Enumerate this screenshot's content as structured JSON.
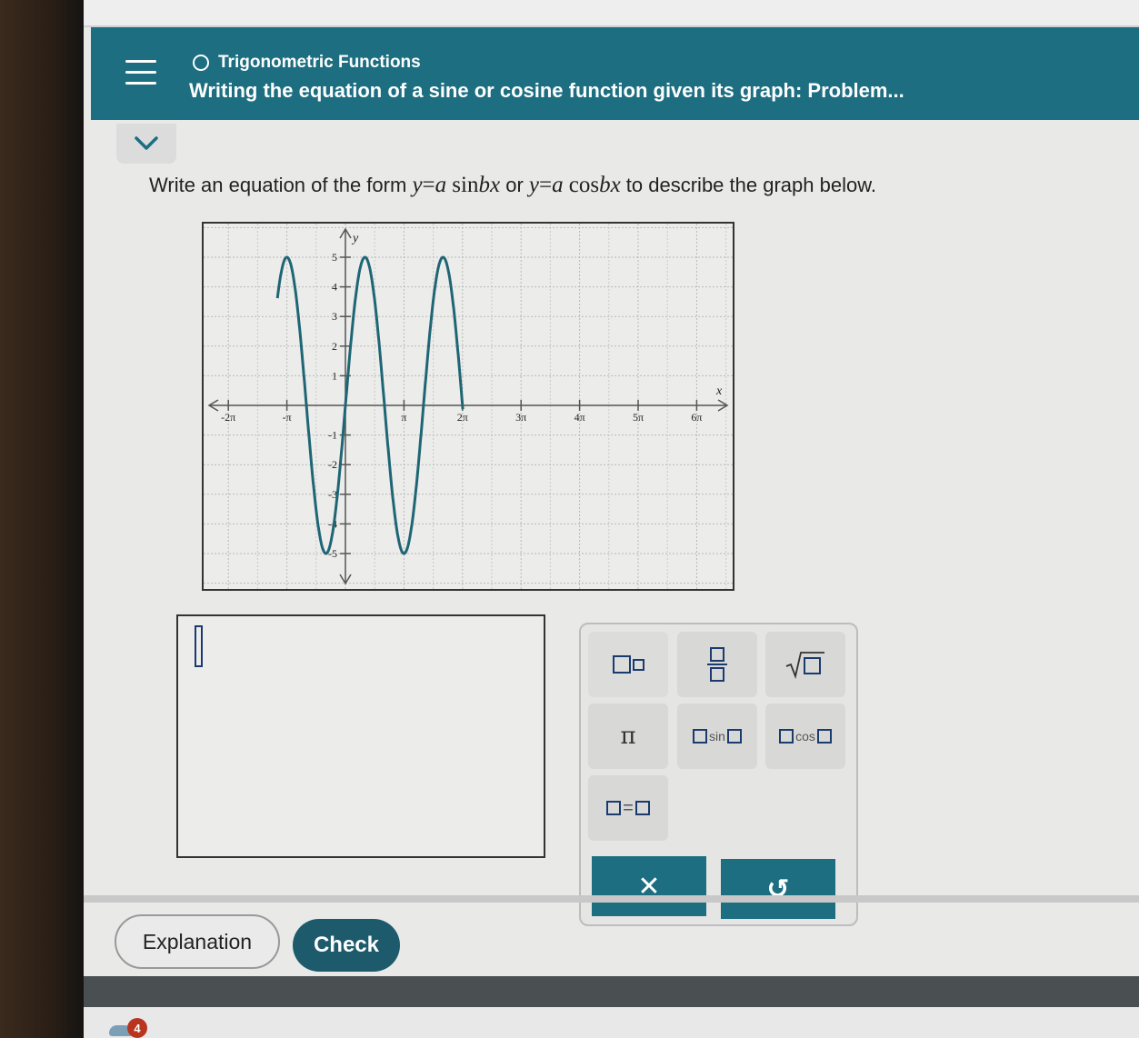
{
  "header": {
    "topic": "Trigonometric Functions",
    "title": "Writing the equation of a sine or cosine function given its graph: Problem..."
  },
  "instructions": {
    "before": "Write an equation of the form",
    "y1": "y",
    "eq1": "=",
    "a1": "a",
    "sin": "sin",
    "bx1": "bx",
    "or": "or",
    "y2": "y",
    "eq2": "=",
    "a2": "a",
    "cos": "cos",
    "bx2": "bx",
    "after": "to describe the graph below."
  },
  "chart_data": {
    "type": "line",
    "xlabel": "x",
    "ylabel": "y",
    "xlim": [
      -3.65,
      6.3
    ],
    "ylim": [
      -6,
      6
    ],
    "x_ticks": [
      "-2π",
      "-π",
      "π",
      "2π",
      "3π",
      "4π",
      "5π",
      "6π"
    ],
    "y_ticks": [
      "5",
      "4",
      "3",
      "2",
      "1",
      "-1",
      "-2",
      "-3",
      "-4",
      "-5"
    ],
    "series": [
      {
        "function": "y = 5 sin(3x/2)",
        "amplitude": 5,
        "period": "4π/3",
        "x": [
          -3.4,
          -3.14,
          -2.6,
          -2.09,
          -1.6,
          -1.05,
          -0.5,
          0,
          0.5,
          1.05,
          1.6,
          2.09,
          2.6,
          3.14,
          3.7,
          4.19,
          4.7,
          5.24,
          5.76,
          6.28
        ],
        "y": [
          4.6,
          0,
          -3.5,
          0,
          3.4,
          0,
          -3.5,
          0,
          3.4,
          5,
          3.4,
          0,
          -3.5,
          -5,
          -3.5,
          0,
          3.4,
          5,
          3.4,
          0
        ]
      }
    ],
    "grid": true,
    "color": "#1f6675"
  },
  "answer": {
    "value": ""
  },
  "keypad": {
    "pi": "π",
    "sin": "sin",
    "cos": "cos",
    "equals": "="
  },
  "actions": {
    "clear": "✕",
    "undo": "↺"
  },
  "buttons": {
    "explanation": "Explanation",
    "check": "Check"
  },
  "footer": {
    "badge": "4"
  }
}
